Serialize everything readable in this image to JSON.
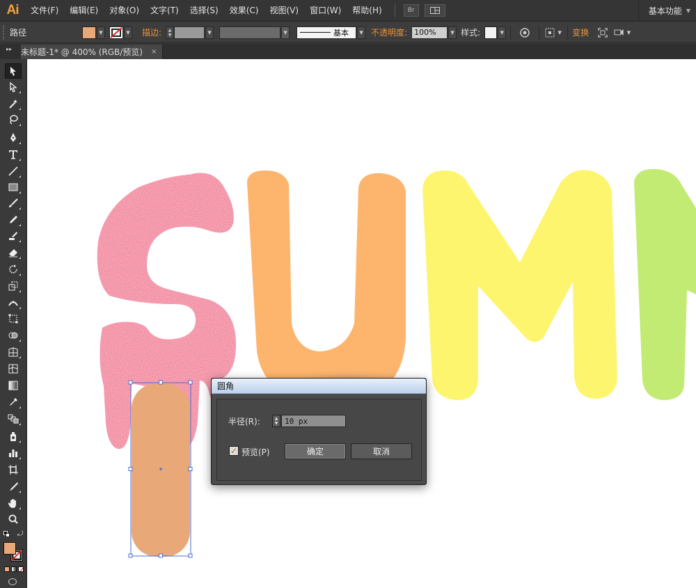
{
  "app": {
    "logo": "Ai",
    "workspace": "基本功能"
  },
  "menu": {
    "items": [
      "文件(F)",
      "编辑(E)",
      "对象(O)",
      "文字(T)",
      "选择(S)",
      "效果(C)",
      "视图(V)",
      "窗口(W)",
      "帮助(H)"
    ],
    "bridge_label": "Br"
  },
  "control_bar": {
    "object_type": "路径",
    "stroke_label": "描边:",
    "stroke_style": "基本",
    "opacity_label": "不透明度:",
    "opacity_value": "100%",
    "style_label": "样式:",
    "transform_label": "变换",
    "fill_color": "#E8A878"
  },
  "document": {
    "tab_title": "未标题-1* @ 400% (RGB/预览)",
    "close_glyph": "×"
  },
  "toolbox": {
    "collapse_glyph": "▸▸"
  },
  "artwork": {
    "letters": [
      "S",
      "U",
      "M",
      "M"
    ],
    "colors": {
      "s": "#F04E7C",
      "u": "#FDB56E",
      "m1": "#FEF56E",
      "m2": "#C1EB72",
      "stick": "#E8A878",
      "selection": "#4A6CD4"
    }
  },
  "dialog": {
    "title": "圆角",
    "radius_label": "半径(R):",
    "radius_value": "10 px",
    "preview_label": "预览(P)",
    "preview_checked": "✓",
    "ok_label": "确定",
    "cancel_label": "取消"
  }
}
